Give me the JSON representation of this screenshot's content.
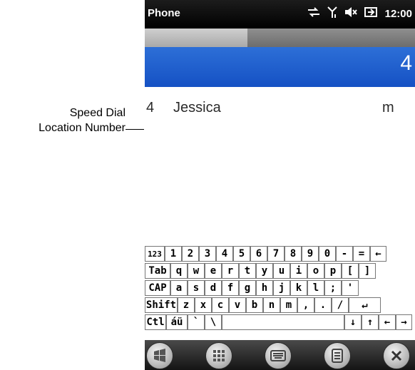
{
  "callout": {
    "line1": "Speed Dial",
    "line2": "Location Number"
  },
  "titlebar": {
    "title": "Phone",
    "time": "12:00"
  },
  "dial": {
    "value": "4",
    "progress_fraction": 0.38
  },
  "contacts": [
    {
      "location": "4",
      "name": "Jessica",
      "type": "m"
    }
  ],
  "keyboard": {
    "rows": [
      [
        "123",
        "1",
        "2",
        "3",
        "4",
        "5",
        "6",
        "7",
        "8",
        "9",
        "0",
        "-",
        "=",
        "←"
      ],
      [
        "Tab",
        "q",
        "w",
        "e",
        "r",
        "t",
        "y",
        "u",
        "i",
        "o",
        "p",
        "[",
        "]"
      ],
      [
        "CAP",
        "a",
        "s",
        "d",
        "f",
        "g",
        "h",
        "j",
        "k",
        "l",
        ";",
        "'"
      ],
      [
        "Shift",
        "z",
        "x",
        "c",
        "v",
        "b",
        "n",
        "m",
        ",",
        ".",
        "/",
        "↵"
      ],
      [
        "Ctl",
        "áü",
        "`",
        "\\",
        "",
        "↓",
        "↑",
        "←",
        "→"
      ]
    ]
  },
  "taskbar": {
    "icons": [
      "windows-start-icon",
      "keypad-icon",
      "keyboard-icon",
      "menu-icon",
      "close-icon"
    ]
  },
  "colors": {
    "accent_blue": "#1b5ccc",
    "titlebar": "#000000",
    "taskbar": "#1f1f1f"
  }
}
